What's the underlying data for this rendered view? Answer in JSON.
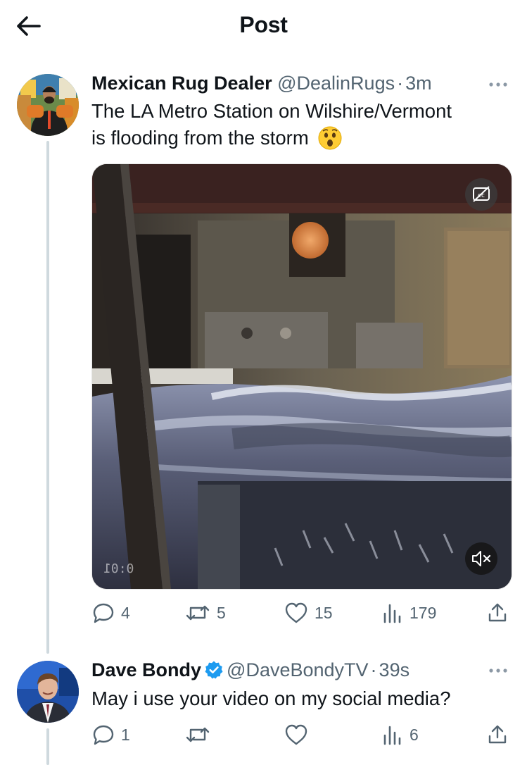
{
  "header": {
    "title": "Post"
  },
  "main_post": {
    "display_name": "Mexican Rug Dealer",
    "handle": "@DealinRugs",
    "separator": "·",
    "time": "3m",
    "text_line1": "The LA Metro Station on Wilshire/Vermont",
    "text_line2": "is flooding from the storm",
    "emoji_name": "astonished-face",
    "video": {
      "timestamp": "0:01",
      "muted": true,
      "captions_off": true
    },
    "actions": {
      "replies": "4",
      "reposts": "5",
      "likes": "15",
      "views": "179"
    }
  },
  "reply_post": {
    "display_name": "Dave Bondy",
    "verified": true,
    "handle": "@DaveBondyTV",
    "separator": "·",
    "time": "39s",
    "text": "May i use your video on my social media?",
    "actions": {
      "replies": "1",
      "reposts": "",
      "likes": "",
      "views": "6"
    }
  },
  "colors": {
    "text": "#0f1419",
    "secondary": "#536471",
    "verified": "#1d9bf0",
    "thread_line": "#cfd9de"
  }
}
